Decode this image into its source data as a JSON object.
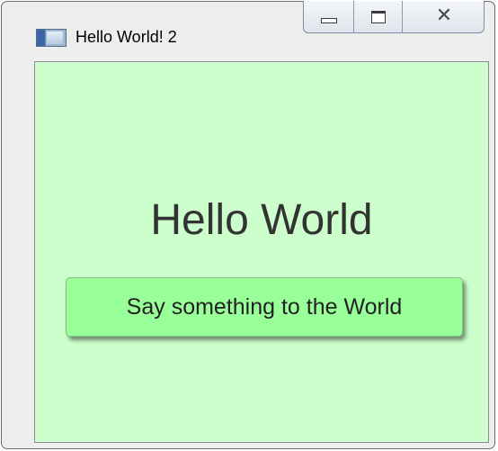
{
  "window": {
    "title": "Hello World! 2",
    "caption_buttons": {
      "minimize": "minimize-icon",
      "maximize": "maximize-icon",
      "close": "close-icon",
      "close_glyph": "✕"
    }
  },
  "content": {
    "heading": "Hello World",
    "button_label": "Say something to the World"
  },
  "colors": {
    "client_background": "#ccffcc",
    "button_background": "#99ff99",
    "heading_text": "#333333"
  }
}
